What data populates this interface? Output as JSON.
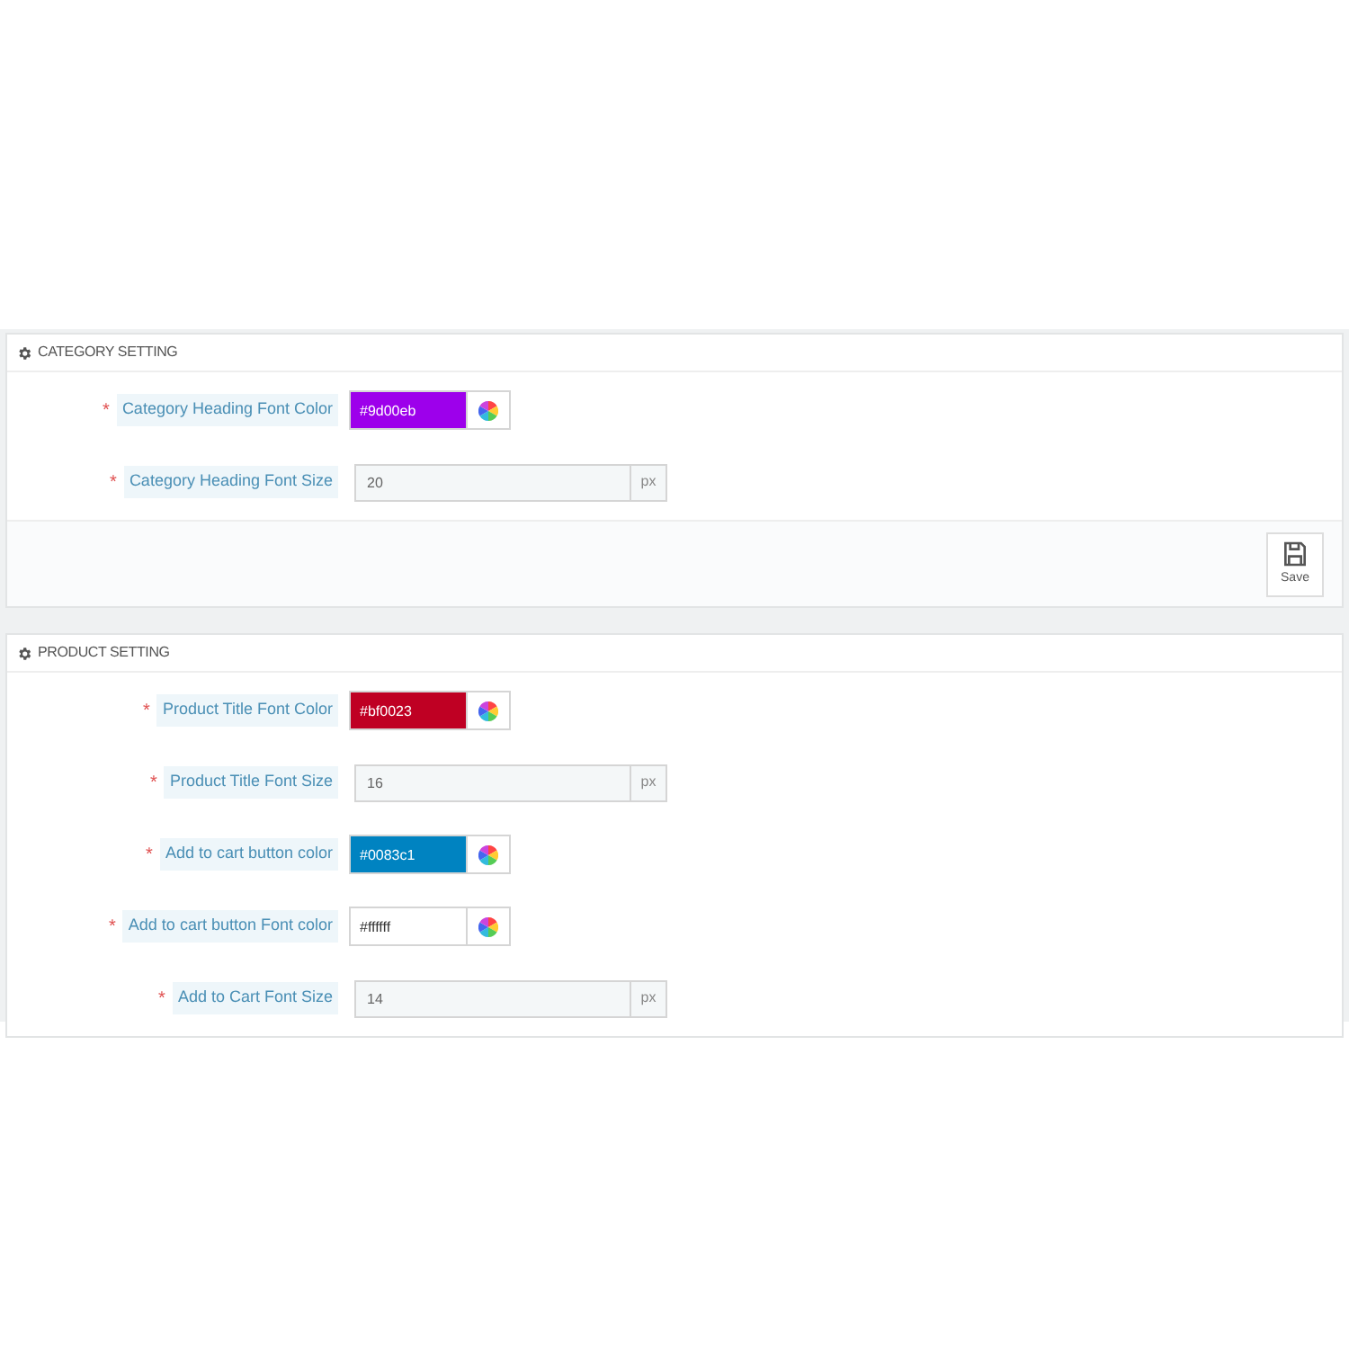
{
  "panels": [
    {
      "title": "CATEGORY SETTING",
      "fields": [
        {
          "kind": "color",
          "label": "Category Heading Font Color",
          "required_mark": "*",
          "value": "#9d00eb",
          "color": "#9d00eb"
        },
        {
          "kind": "size",
          "label": "Category Heading Font Size",
          "required_mark": "*",
          "value": "20",
          "unit": "px"
        }
      ],
      "save_button": "Save"
    },
    {
      "title": "PRODUCT SETTING",
      "fields": [
        {
          "kind": "color",
          "label": "Product Title Font Color",
          "required_mark": "*",
          "value": "#bf0023",
          "color": "#bf0023"
        },
        {
          "kind": "size",
          "label": "Product Title Font Size",
          "required_mark": "*",
          "value": "16",
          "unit": "px"
        },
        {
          "kind": "color",
          "label": "Add to cart button color",
          "required_mark": "*",
          "value": "#0083c1",
          "color": "#0083c1"
        },
        {
          "kind": "color",
          "label": "Add to cart button Font color",
          "required_mark": "*",
          "value": "#ffffff",
          "color": "#ffffff"
        },
        {
          "kind": "size",
          "label": "Add to Cart Font Size",
          "required_mark": "*",
          "value": "14",
          "unit": "px"
        }
      ]
    }
  ]
}
